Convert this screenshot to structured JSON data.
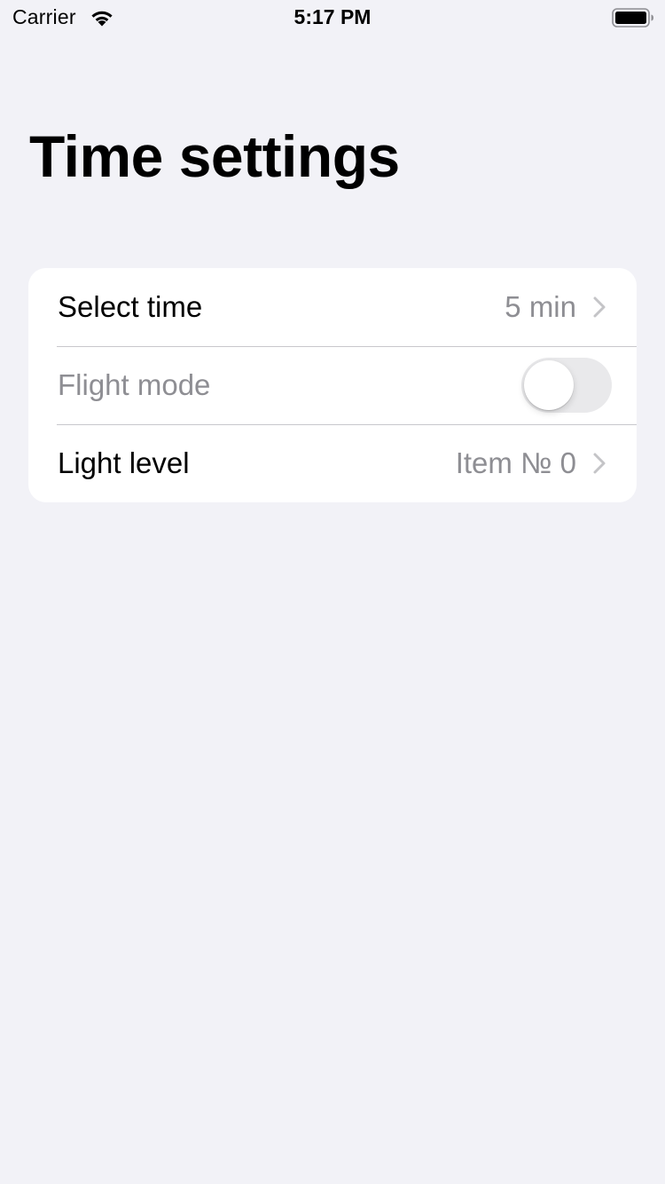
{
  "status_bar": {
    "carrier": "Carrier",
    "time": "5:17 PM",
    "icons": [
      "wifi-icon",
      "battery-icon"
    ]
  },
  "page": {
    "title": "Time settings"
  },
  "settings": {
    "rows": [
      {
        "label": "Select time",
        "value": "5 min",
        "accessory": "chevron-right-icon"
      },
      {
        "label": "Flight mode",
        "toggle": false,
        "disabled": true
      },
      {
        "label": "Light level",
        "value": "Item № 0",
        "accessory": "chevron-right-icon"
      }
    ]
  },
  "colors": {
    "background": "#f2f2f7",
    "card": "#ffffff",
    "secondary_text": "#8e8e93",
    "separator": "#c8c7cc",
    "toggle_off": "#e9e9eb"
  }
}
